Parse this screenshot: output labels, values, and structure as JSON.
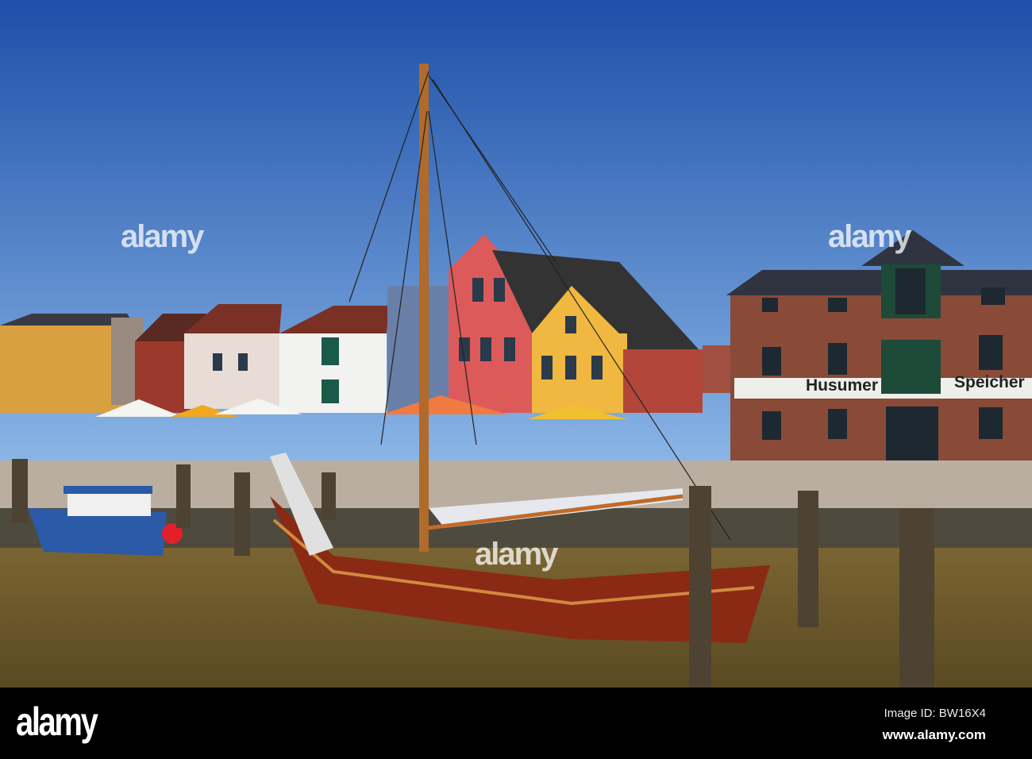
{
  "watermark": {
    "brand": "alamy"
  },
  "building_sign": {
    "left": "Husumer",
    "right": "Speicher"
  },
  "footer": {
    "logo": "alamy",
    "image_id": "Image ID: BW16X4",
    "url": "www.alamy.com"
  },
  "colors": {
    "sky_top": "#1c4fa8",
    "sky_bottom": "#8db8e8",
    "water": "#6b5a2a",
    "hull": "#8a2a14",
    "brick": "#8a4a38"
  }
}
